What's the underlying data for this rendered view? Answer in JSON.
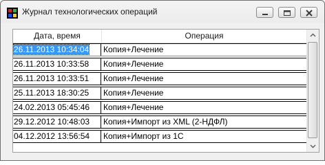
{
  "window": {
    "title": "Журнал технологических операций",
    "icons": {
      "app": "app-icon",
      "minimize": "minimize-icon",
      "maximize": "maximize-icon",
      "close": "close-icon"
    }
  },
  "table": {
    "columns": [
      "Дата, время",
      "Операция"
    ],
    "rows": [
      {
        "datetime": "26.11.2013 10:34:04",
        "operation": "Копия+Лечение",
        "selected": true
      },
      {
        "datetime": "26.11.2013 10:33:58",
        "operation": "Копия+Лечение"
      },
      {
        "datetime": "26.11.2013 10:33:51",
        "operation": "Копия+Лечение"
      },
      {
        "datetime": "25.11.2013 18:30:25",
        "operation": "Копия+Лечение"
      },
      {
        "datetime": "24.02.2013 05:45:46",
        "operation": "Копия+Лечение"
      },
      {
        "datetime": "29.12.2012 10:48:03",
        "operation": "Копия+Импорт из XML (2-НДФЛ)"
      },
      {
        "datetime": "04.12.2012 13:56:54",
        "operation": "Копия+Импорт из 1С"
      }
    ]
  },
  "colors": {
    "selection": "#3399ff",
    "window_bg": "#f0f0f0"
  }
}
